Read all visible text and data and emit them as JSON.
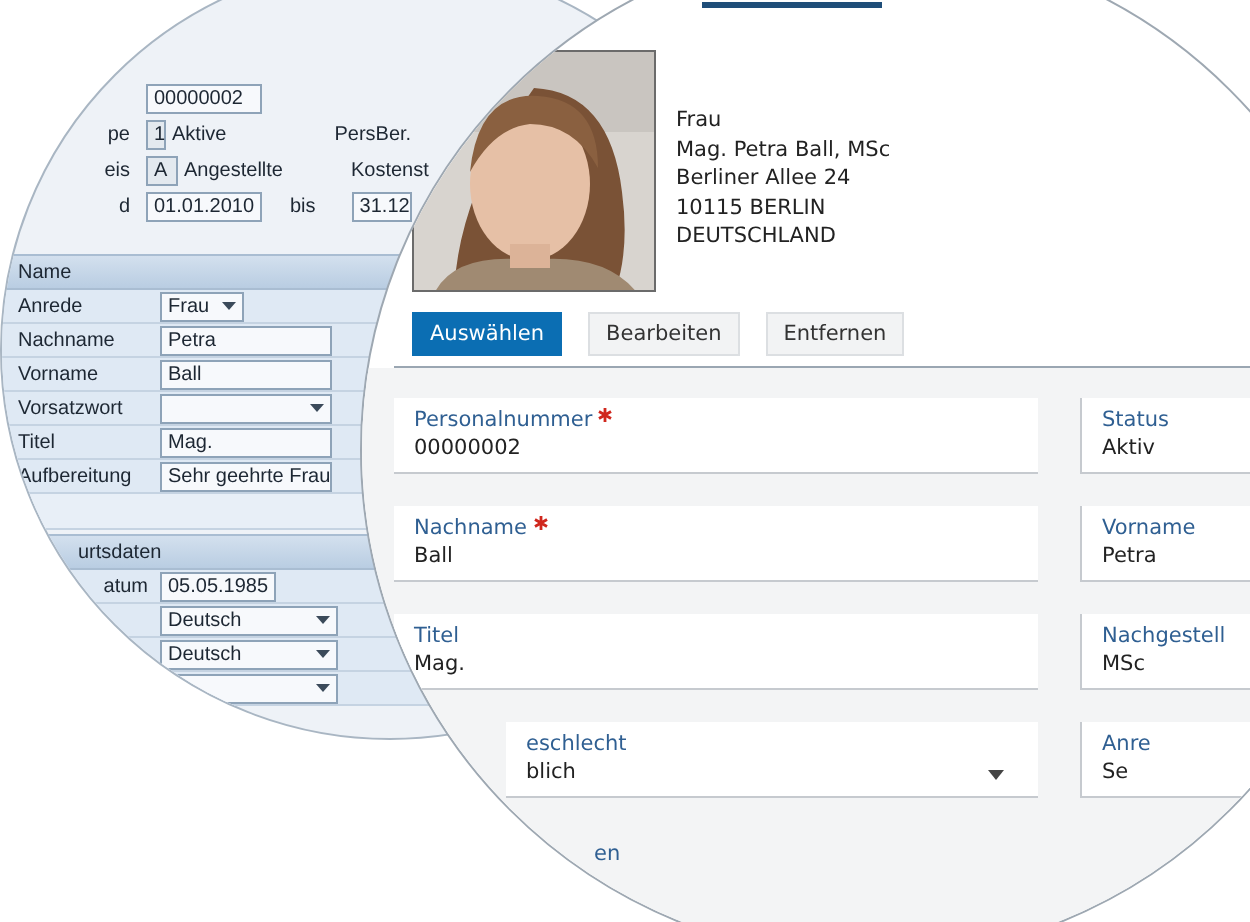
{
  "legacy_form": {
    "personnel_number": "00000002",
    "rows": [
      {
        "label": "pe",
        "code": "1",
        "text": "Aktive",
        "right_label": "PersBer."
      },
      {
        "label": "eis",
        "code": "A",
        "text": "Angestellte",
        "right_label": "Kostenst"
      }
    ],
    "validity": {
      "label": "d",
      "from": "01.01.2010",
      "to_label": "bis",
      "to": "31.12"
    },
    "name_section": {
      "title": "Name",
      "rows": [
        {
          "label": "Anrede",
          "kind": "select",
          "value": "Frau"
        },
        {
          "label": "Nachname",
          "kind": "text",
          "value": "Petra"
        },
        {
          "label": "Vorname",
          "kind": "text",
          "value": "Ball"
        },
        {
          "label": "Vorsatzwort",
          "kind": "dropdown"
        },
        {
          "label": "Titel",
          "kind": "text",
          "value": "Mag."
        },
        {
          "label": "Aufbereitung",
          "kind": "text",
          "value": "Sehr geehrte Frau"
        }
      ]
    },
    "birth_section": {
      "title": "urtsdaten",
      "rows": [
        {
          "label": "atum",
          "kind": "date",
          "value": "05.05.1985"
        },
        {
          "kind": "dropdown",
          "value": "Deutsch"
        },
        {
          "kind": "dropdown",
          "value": "Deutsch"
        },
        {
          "kind": "dropdown"
        }
      ]
    }
  },
  "profile": {
    "photo": {
      "kind": "picture"
    },
    "address_lines": [
      "Frau",
      "Mag. Petra Ball, MSc",
      "Berliner Allee 24",
      "10115 BERLIN",
      "DEUTSCHLAND"
    ]
  },
  "actions": [
    {
      "label": "Auswählen",
      "primary": true
    },
    {
      "label": "Bearbeiten",
      "primary": false
    },
    {
      "label": "Entfernen",
      "primary": false
    }
  ],
  "fields": [
    {
      "cells": [
        {
          "label": "Personalnummer",
          "required": true,
          "kind": "text",
          "value": "00000002"
        },
        {
          "label": "Status",
          "required": false,
          "kind": "text",
          "value": "Aktiv"
        }
      ]
    },
    {
      "cells": [
        {
          "label": "Nachname",
          "required": true,
          "kind": "text",
          "value": "Ball"
        },
        {
          "label": "Vorname",
          "required": false,
          "kind": "text",
          "value": "Petra"
        }
      ]
    },
    {
      "cells": [
        {
          "label": "Titel",
          "required": false,
          "kind": "text",
          "value": "Mag."
        },
        {
          "label": "Nachgestell",
          "required": false,
          "kind": "text",
          "value": "MSc"
        }
      ]
    },
    {
      "cells": [
        {
          "label": "eschlecht",
          "required": false,
          "kind": "dropdown",
          "value": "blich"
        },
        {
          "label": "Anre",
          "required": false,
          "kind": "text",
          "value": "Se"
        }
      ]
    }
  ],
  "section_heading": "en"
}
